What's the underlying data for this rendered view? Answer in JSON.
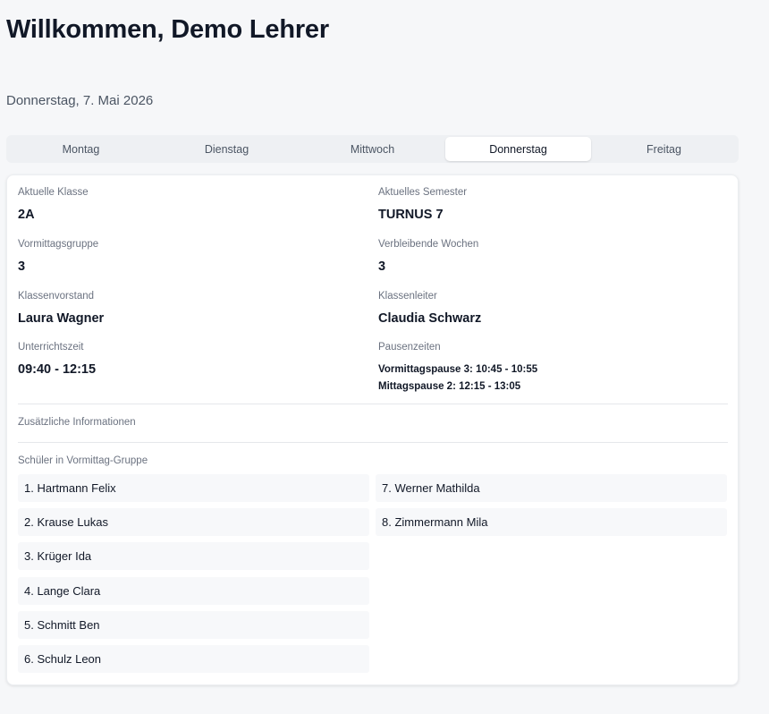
{
  "header": {
    "title": "Willkommen, Demo Lehrer",
    "date": "Donnerstag, 7. Mai 2026"
  },
  "tabs": [
    {
      "label": "Montag",
      "active": false
    },
    {
      "label": "Dienstag",
      "active": false
    },
    {
      "label": "Mittwoch",
      "active": false
    },
    {
      "label": "Donnerstag",
      "active": true
    },
    {
      "label": "Freitag",
      "active": false
    }
  ],
  "info": {
    "current_class": {
      "label": "Aktuelle Klasse",
      "value": "2A"
    },
    "current_semester": {
      "label": "Aktuelles Semester",
      "value": "TURNUS 7"
    },
    "morning_group": {
      "label": "Vormittagsgruppe",
      "value": "3"
    },
    "remaining_weeks": {
      "label": "Verbleibende Wochen",
      "value": "3"
    },
    "class_board": {
      "label": "Klassenvorstand",
      "value": "Laura Wagner"
    },
    "class_leader": {
      "label": "Klassenleiter",
      "value": "Claudia Schwarz"
    },
    "lesson_time": {
      "label": "Unterrichtszeit",
      "value": "09:40 - 12:15"
    },
    "breaks": {
      "label": "Pausenzeiten",
      "items": [
        "Vormittagspause 3: 10:45 - 10:55",
        "Mittagspause 2: 12:15 - 13:05"
      ]
    }
  },
  "additional_info": {
    "label": "Zusätzliche Informationen"
  },
  "students": {
    "label": "Schüler in Vormittag-Gruppe",
    "items": [
      "1. Hartmann Felix",
      "2. Krause Lukas",
      "3. Krüger Ida",
      "4. Lange Clara",
      "5. Schmitt Ben",
      "6. Schulz Leon",
      "7. Werner Mathilda",
      "8. Zimmermann Mila"
    ]
  },
  "colors": {
    "background": "#f6f7f9",
    "card": "#ffffff",
    "text": "#111827",
    "muted": "#6b7280"
  }
}
